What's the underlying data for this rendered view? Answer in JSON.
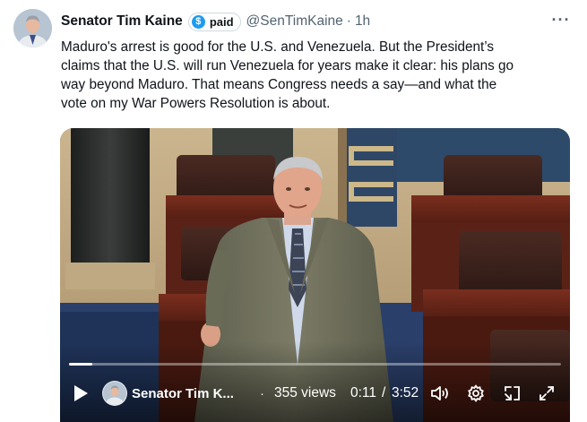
{
  "post": {
    "author_name": "Senator Tim Kaine",
    "badge_label": "paid",
    "badge_icon": "dollar-icon",
    "handle": "@SenTimKaine",
    "separator": "·",
    "timestamp": "1h",
    "more_label": "···",
    "text": "Maduro's arrest is good for the U.S. and Venezuela. But the President’s\nclaims that the U.S. will run Venezuela for years make it clear: his plans go\nway beyond Maduro. That means Congress needs a say—and what the\nvote on my War Powers Resolution is about."
  },
  "video": {
    "channel_name": "Senator Tim K...",
    "separator": "·",
    "views": "355 views",
    "current_time": "0:11",
    "time_separator": "/",
    "total_time": "3:52",
    "progress_fraction": 0.047,
    "icons": [
      "play-icon",
      "volume-icon",
      "settings-gear-icon",
      "dock-icon",
      "fullscreen-icon"
    ]
  },
  "colors": {
    "brand_blue": "#1d9bf0",
    "text_primary": "#0f1419",
    "text_secondary": "#536471"
  }
}
